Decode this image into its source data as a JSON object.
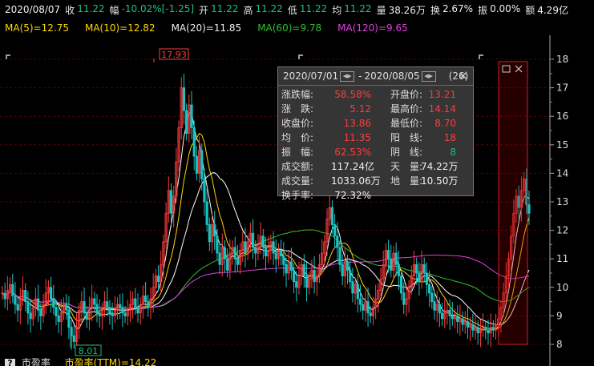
{
  "info": {
    "date": "2020/08/07",
    "close_label": "收",
    "close_value": "11.22",
    "change_label": "幅",
    "change_value": "-10.02%[-1.25]",
    "open_label": "开",
    "open_value": "11.22",
    "high_label": "高",
    "high_value": "11.22",
    "low_label": "低",
    "low_value": "11.22",
    "avg_label": "均",
    "avg_value": "11.22",
    "volume_label": "量",
    "volume_value": "38.26万",
    "turnover_label": "换",
    "turnover_value": "2.67%",
    "amplitude_label": "振",
    "amplitude_value": "0.00%",
    "amount_label": "额",
    "amount_value": "4.29亿"
  },
  "ma": {
    "ma5": "MA(5)=12.75",
    "ma10": "MA(10)=12.82",
    "ma20": "MA(20)=11.85",
    "ma60": "MA(60)=9.78",
    "ma120": "MA(120)=9.65"
  },
  "colors": {
    "up": "#ff3b3b",
    "down": "#19c3c3",
    "ma5": "#ffffff",
    "ma10": "#ffd800",
    "ma20": "#ffffff",
    "ma60": "#2fbf2f",
    "ma120": "#e040e0",
    "grid": "#5a0000"
  },
  "y_axis": {
    "ticks": [
      "18",
      "17",
      "16",
      "15",
      "14",
      "13",
      "12",
      "11",
      "10",
      "9",
      "8"
    ]
  },
  "markers": {
    "high": "17.93",
    "low": "8.01"
  },
  "panel": {
    "range_start": "2020/07/01",
    "range_sep": "-",
    "range_end": "2020/08/05",
    "count": "(26)",
    "rows": [
      {
        "k1": "涨跌幅:",
        "v1": "58.58%",
        "c1": "red",
        "k2": "开盘价:",
        "v2": "13.21",
        "c2": "red"
      },
      {
        "k1": "涨　跌:",
        "v1": "5.12",
        "c1": "red",
        "k2": "最高价:",
        "v2": "14.14",
        "c2": "red"
      },
      {
        "k1": "收盘价:",
        "v1": "13.86",
        "c1": "red",
        "k2": "最低价:",
        "v2": "8.70",
        "c2": "red"
      },
      {
        "k1": "均　价:",
        "v1": "11.35",
        "c1": "red",
        "k2": "阳　线:",
        "v2": "18",
        "c2": "red"
      },
      {
        "k1": "振　幅:",
        "v1": "62.53%",
        "c1": "red",
        "k2": "阴　线:",
        "v2": "8",
        "c2": "green"
      },
      {
        "k1": "成交额:",
        "v1": "117.24亿",
        "c1": "white",
        "k2": "天　量:",
        "v2": "74.22万",
        "c2": "white"
      },
      {
        "k1": "成交量:",
        "v1": "1033.06万",
        "c1": "white",
        "k2": "地　量:",
        "v2": "10.50万",
        "c2": "white"
      },
      {
        "k1": "换手率:",
        "v1": "72.32%",
        "c1": "white",
        "k2": "",
        "v2": "",
        "c2": "white"
      }
    ]
  },
  "bottom": {
    "label1": "市盈率",
    "label2": "市盈率(TTM)=14.22",
    "q": "?"
  },
  "price_series": [
    9.8,
    9.6,
    9.9,
    10.1,
    9.7,
    9.4,
    9.2,
    9.6,
    9.9,
    9.5,
    9.1,
    8.9,
    9.3,
    9.6,
    9.2,
    9.0,
    9.4,
    9.8,
    10.0,
    9.6,
    9.3,
    9.0,
    8.8,
    9.1,
    9.4,
    9.2,
    8.6,
    8.3,
    8.1,
    8.6,
    9.2,
    9.5,
    9.1,
    8.9,
    9.3,
    9.6,
    9.4,
    9.1,
    9.0,
    9.2,
    9.5,
    9.3,
    9.1,
    9.0,
    9.2,
    9.4,
    9.3,
    9.1,
    9.0,
    9.2,
    9.4,
    9.6,
    9.3,
    9.1,
    9.4,
    9.7,
    9.5,
    9.3,
    9.6,
    10.0,
    10.4,
    10.2,
    10.8,
    11.6,
    12.6,
    13.4,
    12.6,
    13.2,
    14.4,
    15.6,
    17.0,
    16.2,
    15.4,
    16.4,
    15.6,
    14.6,
    14.0,
    14.8,
    13.8,
    13.0,
    12.2,
    11.6,
    12.2,
    11.8,
    11.2,
    10.8,
    11.4,
    11.0,
    10.6,
    11.2,
    11.4,
    11.0,
    10.8,
    11.3,
    11.6,
    11.2,
    11.6,
    11.9,
    11.4,
    11.2,
    11.5,
    11.8,
    11.4,
    11.1,
    11.3,
    11.6,
    11.2,
    11.0,
    11.3,
    11.1,
    10.8,
    10.5,
    10.9,
    10.6,
    10.2,
    10.0,
    10.4,
    10.8,
    10.4,
    10.0,
    10.3,
    10.6,
    10.2,
    10.4,
    10.8,
    11.2,
    11.6,
    12.4,
    12.8,
    12.2,
    11.8,
    11.4,
    10.8,
    10.4,
    10.9,
    10.6,
    10.2,
    9.8,
    10.1,
    9.6,
    9.4,
    9.2,
    9.5,
    9.1,
    9.0,
    9.3,
    9.6,
    9.9,
    10.3,
    10.8,
    11.3,
    11.0,
    10.6,
    11.2,
    10.8,
    10.4,
    9.8,
    9.4,
    9.6,
    10.0,
    10.4,
    10.8,
    10.5,
    10.2,
    10.8,
    10.5,
    10.1,
    9.8,
    9.5,
    9.2,
    9.4,
    9.1,
    8.9,
    9.1,
    9.2,
    9.0,
    8.9,
    9.0,
    8.8,
    8.9,
    8.7,
    8.8,
    8.6,
    8.7,
    8.5,
    8.6,
    8.4,
    8.5,
    8.6,
    8.5,
    8.4,
    8.6,
    8.5,
    8.7,
    8.9,
    9.3,
    9.8,
    10.4,
    11.0,
    11.8,
    12.6,
    13.2,
    12.8,
    13.4,
    13.8,
    12.9,
    12.6
  ]
}
